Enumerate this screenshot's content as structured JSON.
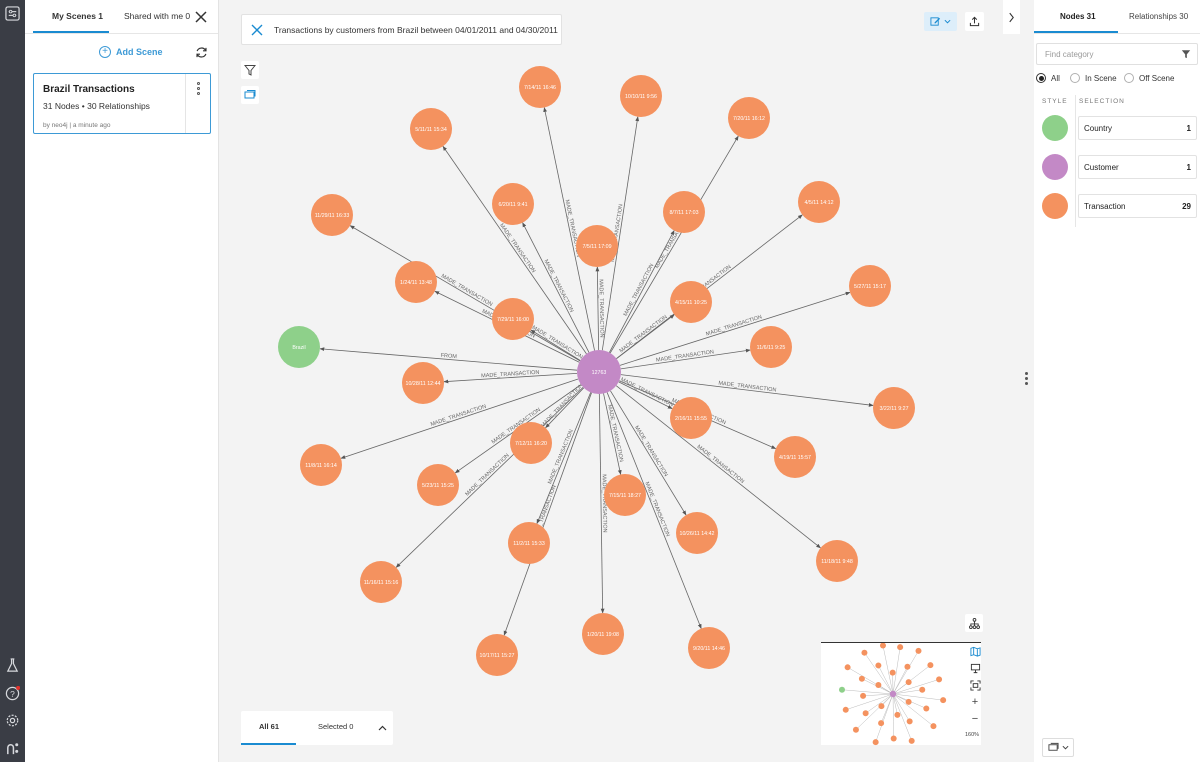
{
  "colors": {
    "accent": "#1a8bd1",
    "country": "#8ed08a",
    "customer": "#c389c6",
    "transaction": "#f4925f",
    "rail": "#3a3d45"
  },
  "scenes_panel": {
    "tab_my_scenes": "My Scenes 1",
    "tab_shared": "Shared with me 0",
    "add_scene_label": "Add Scene",
    "scene": {
      "title": "Brazil Transactions",
      "subtitle": "31 Nodes • 30 Relationships",
      "meta": "by neo4j | a minute ago"
    }
  },
  "canvas": {
    "search_query": "Transactions by customers from Brazil between 04/01/2011 and 04/30/2011",
    "bottom_tab_all": "All 61",
    "bottom_tab_selected": "Selected 0",
    "zoom_level": "160%"
  },
  "graph": {
    "center": {
      "id": "12763",
      "category": "customer"
    },
    "country": {
      "label": "Brazil",
      "rel": "FROM"
    },
    "rel_label": "MADE_TRANSACTION",
    "transactions": [
      "7/14/11 16:46",
      "10/10/11 9:56",
      "5/11/11 15:34",
      "7/20/11 16:12",
      "6/20/11 9:41",
      "8/7/11 17:03",
      "11/29/11 16:33",
      "7/5/11 17:09",
      "4/5/11 14:12",
      "1/24/11 13:48",
      "4/15/11 10:25",
      "5/27/11 15:17",
      "7/29/11 16:00",
      "11/6/11 9:25",
      "10/28/11 12:44",
      "3/22/11 9:27",
      "2/16/11 15:55",
      "7/12/11 16:20",
      "4/19/11 15:57",
      "11/8/11 16:14",
      "5/23/11 15:25",
      "7/15/11 18:27",
      "10/26/11 14:42",
      "11/2/11 15:33",
      "11/18/11 9:48",
      "11/16/11 15:16",
      "1/20/11 19:08",
      "9/20/11 14:46",
      "10/17/11 15:27"
    ]
  },
  "right_panel": {
    "tab_nodes": "Nodes 31",
    "tab_relationships": "Relationships 30",
    "category_placeholder": "Find category",
    "radio_all": "All",
    "radio_in_scene": "In Scene",
    "radio_off_scene": "Off Scene",
    "col_style": "STYLE",
    "col_selection": "SELECTION",
    "categories": [
      {
        "name": "Country",
        "count": "1"
      },
      {
        "name": "Customer",
        "count": "1"
      },
      {
        "name": "Transaction",
        "count": "29"
      }
    ]
  }
}
